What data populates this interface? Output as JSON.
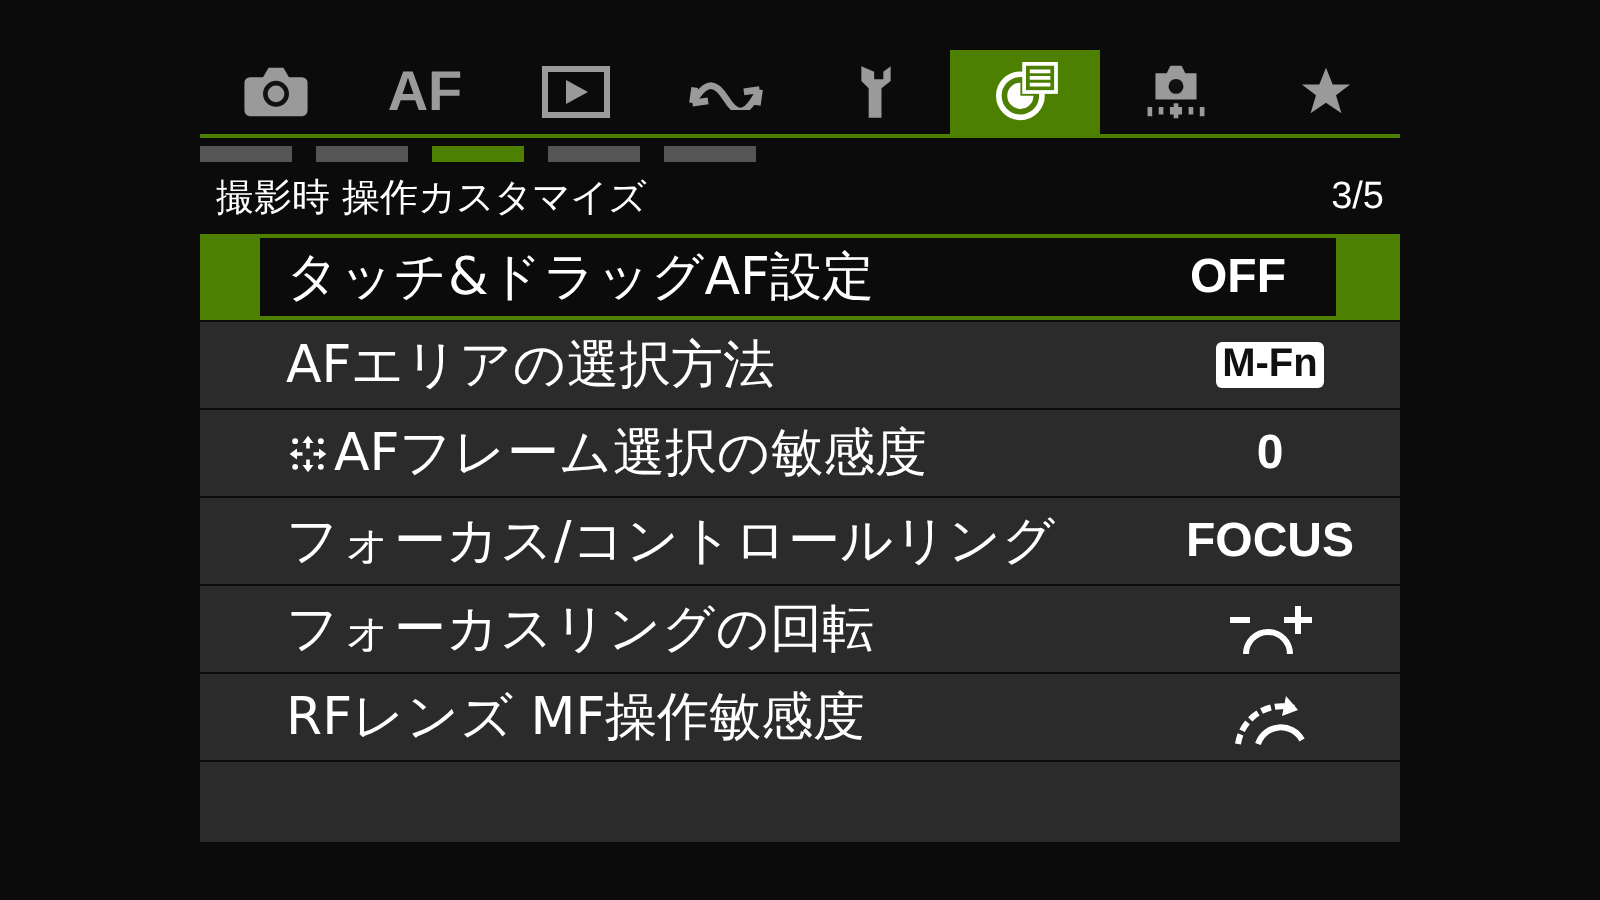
{
  "tabs": [
    {
      "kind": "camera",
      "selected": false
    },
    {
      "kind": "text",
      "label": "AF",
      "selected": false
    },
    {
      "kind": "play",
      "selected": false
    },
    {
      "kind": "wave",
      "selected": false
    },
    {
      "kind": "wrench",
      "selected": false
    },
    {
      "kind": "custom",
      "selected": true
    },
    {
      "kind": "camera-dots",
      "selected": false
    },
    {
      "kind": "star",
      "selected": false
    }
  ],
  "pages": [
    {
      "selected": false
    },
    {
      "selected": false
    },
    {
      "selected": true
    },
    {
      "selected": false
    },
    {
      "selected": false
    }
  ],
  "header": {
    "title": "撮影時 操作カスタマイズ",
    "page": "3/5"
  },
  "items": [
    {
      "label": "タッチ&ドラッグAF設定",
      "arrows_icon": false,
      "kind": "text",
      "value": "OFF",
      "selected": true
    },
    {
      "label": "AFエリアの選択方法",
      "arrows_icon": false,
      "kind": "badge",
      "value": "M-Fn",
      "selected": false
    },
    {
      "label": "AFフレーム選択の敏感度",
      "arrows_icon": true,
      "kind": "text",
      "value": "0",
      "selected": false
    },
    {
      "label": "フォーカス/コントロールリング",
      "arrows_icon": false,
      "kind": "text",
      "value": "FOCUS",
      "selected": false
    },
    {
      "label": "フォーカスリングの回転",
      "arrows_icon": false,
      "kind": "direction-icon",
      "selected": false
    },
    {
      "label": "RFレンズ MF操作敏感度",
      "arrows_icon": false,
      "kind": "sensitivity-icon",
      "selected": false
    }
  ]
}
